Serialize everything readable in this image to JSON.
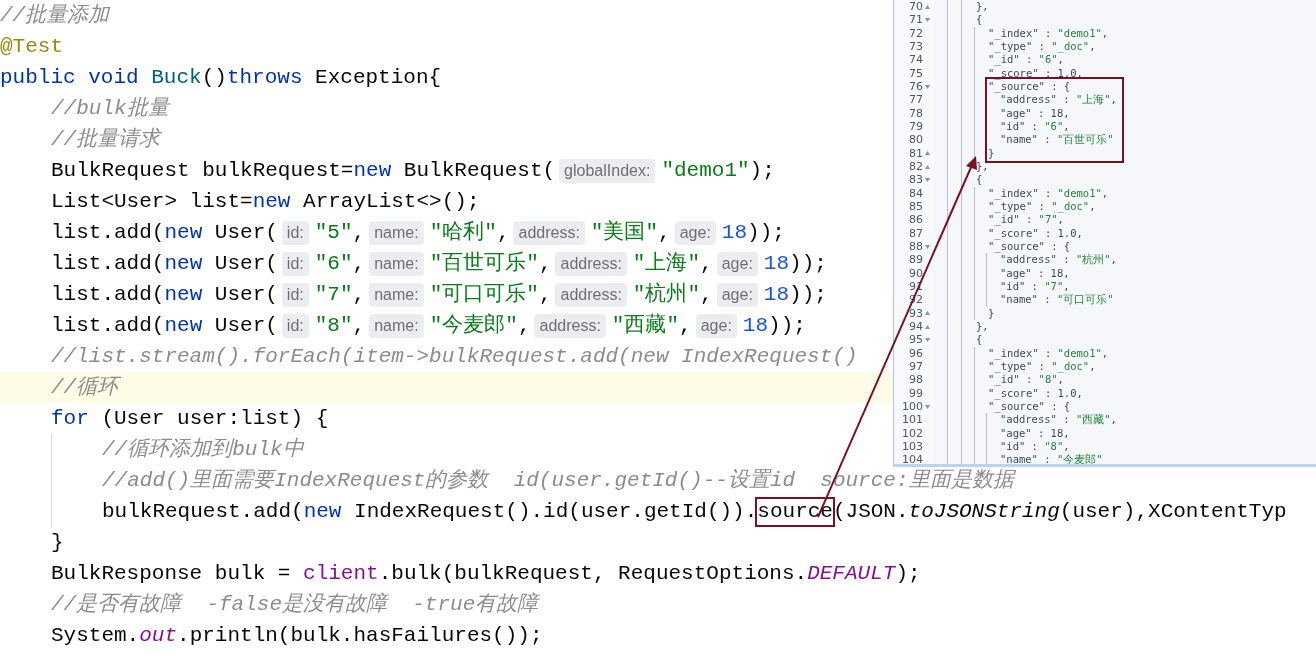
{
  "code": {
    "lines": [
      {
        "current": false,
        "tokens": [
          {
            "kind": "comment",
            "text": "//批量添加"
          }
        ]
      },
      {
        "current": false,
        "tokens": [
          {
            "kind": "annotation",
            "text": "@Test"
          }
        ]
      },
      {
        "current": false,
        "tokens": [
          {
            "kind": "keyword",
            "text": "public void "
          },
          {
            "kind": "method_decl",
            "text": "Buck"
          },
          {
            "kind": "plain",
            "text": "()"
          },
          {
            "kind": "keyword",
            "text": "throws"
          },
          {
            "kind": "plain",
            "text": " Exception{"
          }
        ],
        "children": [
          {
            "current": false,
            "tokens": [
              {
                "kind": "comment",
                "text": "//bulk批量"
              }
            ]
          },
          {
            "current": false,
            "tokens": [
              {
                "kind": "comment",
                "text": "//批量请求"
              }
            ]
          },
          {
            "current": false,
            "tokens": [
              {
                "kind": "plain",
                "text": "BulkRequest bulkRequest="
              },
              {
                "kind": "keyword",
                "text": "new"
              },
              {
                "kind": "plain",
                "text": " BulkRequest("
              },
              {
                "kind": "hint",
                "text": "globalIndex:"
              },
              {
                "kind": "string",
                "text": "\"demo1\""
              },
              {
                "kind": "plain",
                "text": ");"
              }
            ]
          },
          {
            "current": false,
            "tokens": [
              {
                "kind": "plain",
                "text": "List<User> list="
              },
              {
                "kind": "keyword",
                "text": "new"
              },
              {
                "kind": "plain",
                "text": " ArrayList<>();"
              }
            ]
          },
          {
            "current": false,
            "tokens": [
              {
                "kind": "plain",
                "text": "list.add("
              },
              {
                "kind": "keyword",
                "text": "new"
              },
              {
                "kind": "plain",
                "text": " User("
              },
              {
                "kind": "hint",
                "text": "id:"
              },
              {
                "kind": "string",
                "text": "\"5\""
              },
              {
                "kind": "plain",
                "text": ","
              },
              {
                "kind": "hint",
                "text": "name:"
              },
              {
                "kind": "string",
                "text": "\"哈利\""
              },
              {
                "kind": "plain",
                "text": ","
              },
              {
                "kind": "hint",
                "text": "address:"
              },
              {
                "kind": "string",
                "text": "\"美国\""
              },
              {
                "kind": "plain",
                "text": ","
              },
              {
                "kind": "hint",
                "text": "age:"
              },
              {
                "kind": "number",
                "text": "18"
              },
              {
                "kind": "plain",
                "text": "));"
              }
            ]
          },
          {
            "current": false,
            "tokens": [
              {
                "kind": "plain",
                "text": "list.add("
              },
              {
                "kind": "keyword",
                "text": "new"
              },
              {
                "kind": "plain",
                "text": " User("
              },
              {
                "kind": "hint",
                "text": "id:"
              },
              {
                "kind": "string",
                "text": "\"6\""
              },
              {
                "kind": "plain",
                "text": ","
              },
              {
                "kind": "hint",
                "text": "name:"
              },
              {
                "kind": "string",
                "text": "\"百世可乐\""
              },
              {
                "kind": "plain",
                "text": ","
              },
              {
                "kind": "hint",
                "text": "address:"
              },
              {
                "kind": "string",
                "text": "\"上海\""
              },
              {
                "kind": "plain",
                "text": ","
              },
              {
                "kind": "hint",
                "text": "age:"
              },
              {
                "kind": "number",
                "text": "18"
              },
              {
                "kind": "plain",
                "text": "));"
              }
            ]
          },
          {
            "current": false,
            "tokens": [
              {
                "kind": "plain",
                "text": "list.add("
              },
              {
                "kind": "keyword",
                "text": "new"
              },
              {
                "kind": "plain",
                "text": " User("
              },
              {
                "kind": "hint",
                "text": "id:"
              },
              {
                "kind": "string",
                "text": "\"7\""
              },
              {
                "kind": "plain",
                "text": ","
              },
              {
                "kind": "hint",
                "text": "name:"
              },
              {
                "kind": "string",
                "text": "\"可口可乐\""
              },
              {
                "kind": "plain",
                "text": ","
              },
              {
                "kind": "hint",
                "text": "address:"
              },
              {
                "kind": "string",
                "text": "\"杭州\""
              },
              {
                "kind": "plain",
                "text": ","
              },
              {
                "kind": "hint",
                "text": "age:"
              },
              {
                "kind": "number",
                "text": "18"
              },
              {
                "kind": "plain",
                "text": "));"
              }
            ]
          },
          {
            "current": false,
            "tokens": [
              {
                "kind": "plain",
                "text": "list.add("
              },
              {
                "kind": "keyword",
                "text": "new"
              },
              {
                "kind": "plain",
                "text": " User("
              },
              {
                "kind": "hint",
                "text": "id:"
              },
              {
                "kind": "string",
                "text": "\"8\""
              },
              {
                "kind": "plain",
                "text": ","
              },
              {
                "kind": "hint",
                "text": "name:"
              },
              {
                "kind": "string",
                "text": "\"今麦郎\""
              },
              {
                "kind": "plain",
                "text": ","
              },
              {
                "kind": "hint",
                "text": "address:"
              },
              {
                "kind": "string",
                "text": "\"西藏\""
              },
              {
                "kind": "plain",
                "text": ","
              },
              {
                "kind": "hint",
                "text": "age:"
              },
              {
                "kind": "number",
                "text": "18"
              },
              {
                "kind": "plain",
                "text": "));"
              }
            ]
          },
          {
            "current": false,
            "tokens": [
              {
                "kind": "comment",
                "text": "//list.stream().forEach(item->bulkRequest.add(new IndexRequest()"
              }
            ]
          },
          {
            "current": true,
            "tokens": [
              {
                "kind": "comment",
                "text": "//循环"
              }
            ]
          },
          {
            "current": false,
            "tokens": [
              {
                "kind": "keyword",
                "text": "for"
              },
              {
                "kind": "plain",
                "text": " (User user:list) {"
              }
            ],
            "children": [
              {
                "current": false,
                "tokens": [
                  {
                    "kind": "comment",
                    "text": "//循环添加到bulk中"
                  }
                ]
              },
              {
                "current": false,
                "tokens": [
                  {
                    "kind": "comment",
                    "text": "//add()里面需要IndexRequest的参数  id(user.getId()--设置id  source:里面是数据"
                  }
                ]
              },
              {
                "current": false,
                "tokens": [
                  {
                    "kind": "plain",
                    "text": "bulkRequest.add("
                  },
                  {
                    "kind": "keyword",
                    "text": "new"
                  },
                  {
                    "kind": "plain",
                    "text": " IndexRequest().id(user.getId())."
                  },
                  {
                    "kind": "boxed",
                    "text": "source"
                  },
                  {
                    "kind": "plain",
                    "text": "(JSON."
                  },
                  {
                    "kind": "static_method",
                    "text": "toJSONString"
                  },
                  {
                    "kind": "plain",
                    "text": "(user),XContentTyp"
                  }
                ]
              }
            ]
          },
          {
            "current": false,
            "tokens": [
              {
                "kind": "plain",
                "text": "}"
              }
            ]
          },
          {
            "current": false,
            "tokens": [
              {
                "kind": "plain",
                "text": "BulkResponse bulk = "
              },
              {
                "kind": "field",
                "text": "client"
              },
              {
                "kind": "plain",
                "text": ".bulk(bulkRequest, RequestOptions."
              },
              {
                "kind": "static_field",
                "text": "DEFAULT"
              },
              {
                "kind": "plain",
                "text": ");"
              }
            ]
          },
          {
            "current": false,
            "tokens": [
              {
                "kind": "comment",
                "text": "//是否有故障  -false是没有故障  -true有故障"
              }
            ]
          },
          {
            "current": false,
            "tokens": [
              {
                "kind": "plain",
                "text": "System."
              },
              {
                "kind": "static_field",
                "text": "out"
              },
              {
                "kind": "plain",
                "text": ".println(bulk.hasFailures());"
              }
            ]
          }
        ]
      }
    ]
  },
  "panel": {
    "lines": [
      {
        "number": "70",
        "kind": "closer",
        "outlined": false,
        "tokens": [
          {
            "kind": "punct",
            "text": "},"
          }
        ]
      },
      {
        "number": "71",
        "kind": "opener",
        "outlined": false,
        "tokens": [
          {
            "kind": "punct",
            "text": "{"
          }
        ],
        "children": [
          {
            "number": "72",
            "kind": "entry",
            "outlined": false,
            "tokens": [
              {
                "kind": "key",
                "text": "\"_index\""
              },
              {
                "kind": "punct",
                "text": " : "
              },
              {
                "kind": "string",
                "text": "\"demo1\""
              },
              {
                "kind": "punct",
                "text": ","
              }
            ]
          },
          {
            "number": "73",
            "kind": "entry",
            "outlined": false,
            "tokens": [
              {
                "kind": "key",
                "text": "\"_type\""
              },
              {
                "kind": "punct",
                "text": " : "
              },
              {
                "kind": "string",
                "text": "\"_doc\""
              },
              {
                "kind": "punct",
                "text": ","
              }
            ]
          },
          {
            "number": "74",
            "kind": "entry",
            "outlined": false,
            "tokens": [
              {
                "kind": "key",
                "text": "\"_id\""
              },
              {
                "kind": "punct",
                "text": " : "
              },
              {
                "kind": "string",
                "text": "\"6\""
              },
              {
                "kind": "punct",
                "text": ","
              }
            ]
          },
          {
            "number": "75",
            "kind": "entry",
            "outlined": false,
            "tokens": [
              {
                "kind": "key",
                "text": "\"_score\""
              },
              {
                "kind": "punct",
                "text": " : "
              },
              {
                "kind": "number",
                "text": "1.0"
              },
              {
                "kind": "punct",
                "text": ","
              }
            ]
          },
          {
            "number": "76",
            "kind": "opener",
            "outlined": true,
            "tokens": [
              {
                "kind": "key",
                "text": "\"_source\""
              },
              {
                "kind": "punct",
                "text": " : {"
              }
            ],
            "children": [
              {
                "number": "77",
                "kind": "entry",
                "outlined": false,
                "tokens": [
                  {
                    "kind": "key",
                    "text": "\"address\""
                  },
                  {
                    "kind": "punct",
                    "text": " : "
                  },
                  {
                    "kind": "string",
                    "text": "\"上海\""
                  },
                  {
                    "kind": "punct",
                    "text": ","
                  }
                ]
              },
              {
                "number": "78",
                "kind": "entry",
                "outlined": false,
                "tokens": [
                  {
                    "kind": "key",
                    "text": "\"age\""
                  },
                  {
                    "kind": "punct",
                    "text": " : "
                  },
                  {
                    "kind": "number",
                    "text": "18"
                  },
                  {
                    "kind": "punct",
                    "text": ","
                  }
                ]
              },
              {
                "number": "79",
                "kind": "entry",
                "outlined": false,
                "tokens": [
                  {
                    "kind": "key",
                    "text": "\"id\""
                  },
                  {
                    "kind": "punct",
                    "text": " : "
                  },
                  {
                    "kind": "string",
                    "text": "\"6\""
                  },
                  {
                    "kind": "punct",
                    "text": ","
                  }
                ]
              },
              {
                "number": "80",
                "kind": "entry",
                "outlined": false,
                "tokens": [
                  {
                    "kind": "key",
                    "text": "\"name\""
                  },
                  {
                    "kind": "punct",
                    "text": " : "
                  },
                  {
                    "kind": "string",
                    "text": "\"百世可乐\""
                  }
                ]
              }
            ],
            "end": {
              "number": "81",
              "kind": "closer",
              "tokens": [
                {
                  "kind": "punct",
                  "text": "}"
                }
              ]
            }
          }
        ],
        "end": {
          "number": "82",
          "kind": "closer",
          "tokens": [
            {
              "kind": "punct",
              "text": "},"
            }
          ]
        }
      },
      {
        "number": "83",
        "kind": "opener",
        "outlined": false,
        "tokens": [
          {
            "kind": "punct",
            "text": "{"
          }
        ],
        "children": [
          {
            "number": "84",
            "kind": "entry",
            "outlined": false,
            "tokens": [
              {
                "kind": "key",
                "text": "\"_index\""
              },
              {
                "kind": "punct",
                "text": " : "
              },
              {
                "kind": "string",
                "text": "\"demo1\""
              },
              {
                "kind": "punct",
                "text": ","
              }
            ]
          },
          {
            "number": "85",
            "kind": "entry",
            "outlined": false,
            "tokens": [
              {
                "kind": "key",
                "text": "\"_type\""
              },
              {
                "kind": "punct",
                "text": " : "
              },
              {
                "kind": "string",
                "text": "\"_doc\""
              },
              {
                "kind": "punct",
                "text": ","
              }
            ]
          },
          {
            "number": "86",
            "kind": "entry",
            "outlined": false,
            "tokens": [
              {
                "kind": "key",
                "text": "\"_id\""
              },
              {
                "kind": "punct",
                "text": " : "
              },
              {
                "kind": "string",
                "text": "\"7\""
              },
              {
                "kind": "punct",
                "text": ","
              }
            ]
          },
          {
            "number": "87",
            "kind": "entry",
            "outlined": false,
            "tokens": [
              {
                "kind": "key",
                "text": "\"_score\""
              },
              {
                "kind": "punct",
                "text": " : "
              },
              {
                "kind": "number",
                "text": "1.0"
              },
              {
                "kind": "punct",
                "text": ","
              }
            ]
          },
          {
            "number": "88",
            "kind": "opener",
            "outlined": false,
            "tokens": [
              {
                "kind": "key",
                "text": "\"_source\""
              },
              {
                "kind": "punct",
                "text": " : {"
              }
            ],
            "children": [
              {
                "number": "89",
                "kind": "entry",
                "outlined": false,
                "tokens": [
                  {
                    "kind": "key",
                    "text": "\"address\""
                  },
                  {
                    "kind": "punct",
                    "text": " : "
                  },
                  {
                    "kind": "string",
                    "text": "\"杭州\""
                  },
                  {
                    "kind": "punct",
                    "text": ","
                  }
                ]
              },
              {
                "number": "90",
                "kind": "entry",
                "outlined": false,
                "tokens": [
                  {
                    "kind": "key",
                    "text": "\"age\""
                  },
                  {
                    "kind": "punct",
                    "text": " : "
                  },
                  {
                    "kind": "number",
                    "text": "18"
                  },
                  {
                    "kind": "punct",
                    "text": ","
                  }
                ]
              },
              {
                "number": "91",
                "kind": "entry",
                "outlined": false,
                "tokens": [
                  {
                    "kind": "key",
                    "text": "\"id\""
                  },
                  {
                    "kind": "punct",
                    "text": " : "
                  },
                  {
                    "kind": "string",
                    "text": "\"7\""
                  },
                  {
                    "kind": "punct",
                    "text": ","
                  }
                ]
              },
              {
                "number": "92",
                "kind": "entry",
                "outlined": false,
                "tokens": [
                  {
                    "kind": "key",
                    "text": "\"name\""
                  },
                  {
                    "kind": "punct",
                    "text": " : "
                  },
                  {
                    "kind": "string",
                    "text": "\"可口可乐\""
                  }
                ]
              }
            ],
            "end": {
              "number": "93",
              "kind": "closer",
              "tokens": [
                {
                  "kind": "punct",
                  "text": "}"
                }
              ]
            }
          }
        ],
        "end": {
          "number": "94",
          "kind": "closer",
          "tokens": [
            {
              "kind": "punct",
              "text": "},"
            }
          ]
        }
      },
      {
        "number": "95",
        "kind": "opener",
        "outlined": false,
        "tokens": [
          {
            "kind": "punct",
            "text": "{"
          }
        ],
        "children": [
          {
            "number": "96",
            "kind": "entry",
            "outlined": false,
            "tokens": [
              {
                "kind": "key",
                "text": "\"_index\""
              },
              {
                "kind": "punct",
                "text": " : "
              },
              {
                "kind": "string",
                "text": "\"demo1\""
              },
              {
                "kind": "punct",
                "text": ","
              }
            ]
          },
          {
            "number": "97",
            "kind": "entry",
            "outlined": false,
            "tokens": [
              {
                "kind": "key",
                "text": "\"_type\""
              },
              {
                "kind": "punct",
                "text": " : "
              },
              {
                "kind": "string",
                "text": "\"_doc\""
              },
              {
                "kind": "punct",
                "text": ","
              }
            ]
          },
          {
            "number": "98",
            "kind": "entry",
            "outlined": false,
            "tokens": [
              {
                "kind": "key",
                "text": "\"_id\""
              },
              {
                "kind": "punct",
                "text": " : "
              },
              {
                "kind": "string",
                "text": "\"8\""
              },
              {
                "kind": "punct",
                "text": ","
              }
            ]
          },
          {
            "number": "99",
            "kind": "entry",
            "outlined": false,
            "tokens": [
              {
                "kind": "key",
                "text": "\"_score\""
              },
              {
                "kind": "punct",
                "text": " : "
              },
              {
                "kind": "number",
                "text": "1.0"
              },
              {
                "kind": "punct",
                "text": ","
              }
            ]
          },
          {
            "number": "100",
            "kind": "opener",
            "outlined": false,
            "tokens": [
              {
                "kind": "key",
                "text": "\"_source\""
              },
              {
                "kind": "punct",
                "text": " : {"
              }
            ],
            "children": [
              {
                "number": "101",
                "kind": "entry",
                "outlined": false,
                "tokens": [
                  {
                    "kind": "key",
                    "text": "\"address\""
                  },
                  {
                    "kind": "punct",
                    "text": " : "
                  },
                  {
                    "kind": "string",
                    "text": "\"西藏\""
                  },
                  {
                    "kind": "punct",
                    "text": ","
                  }
                ]
              },
              {
                "number": "102",
                "kind": "entry",
                "outlined": false,
                "tokens": [
                  {
                    "kind": "key",
                    "text": "\"age\""
                  },
                  {
                    "kind": "punct",
                    "text": " : "
                  },
                  {
                    "kind": "number",
                    "text": "18"
                  },
                  {
                    "kind": "punct",
                    "text": ","
                  }
                ]
              },
              {
                "number": "103",
                "kind": "entry",
                "outlined": false,
                "tokens": [
                  {
                    "kind": "key",
                    "text": "\"id\""
                  },
                  {
                    "kind": "punct",
                    "text": " : "
                  },
                  {
                    "kind": "string",
                    "text": "\"8\""
                  },
                  {
                    "kind": "punct",
                    "text": ","
                  }
                ]
              },
              {
                "number": "104",
                "kind": "entry",
                "outlined": false,
                "tokens": [
                  {
                    "kind": "key",
                    "text": "\"name\""
                  },
                  {
                    "kind": "punct",
                    "text": " : "
                  },
                  {
                    "kind": "string",
                    "text": "\"今麦郎\""
                  }
                ]
              }
            ]
          }
        ]
      }
    ]
  }
}
